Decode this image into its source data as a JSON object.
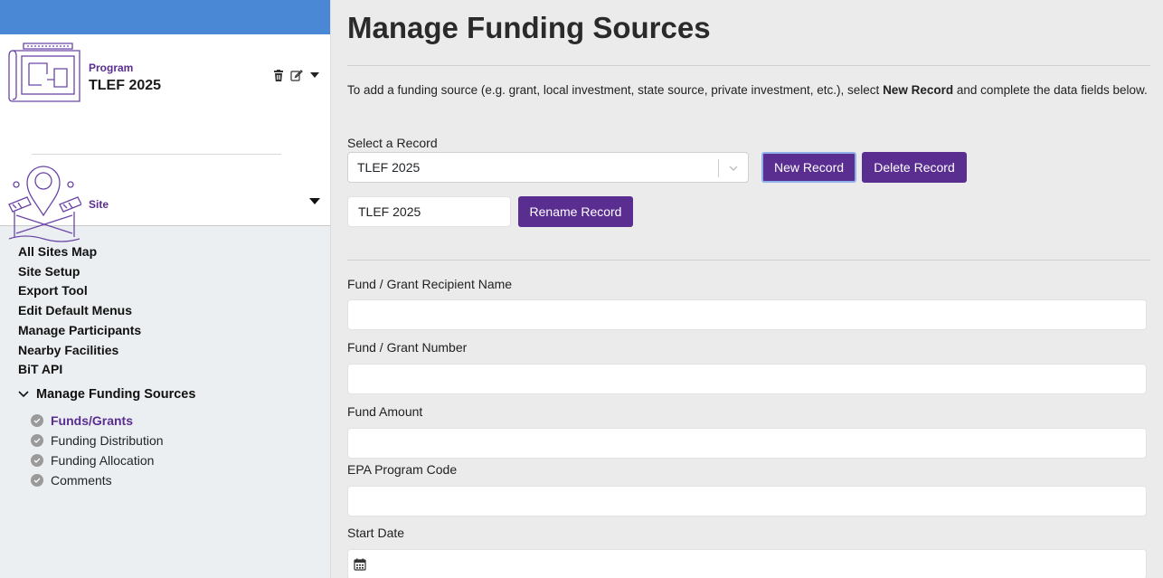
{
  "sidebar": {
    "program": {
      "kicker": "Program",
      "name": "TLEF 2025"
    },
    "site": {
      "label": "Site"
    },
    "nav": [
      {
        "label": "All Sites Map"
      },
      {
        "label": "Site Setup"
      },
      {
        "label": "Export Tool"
      },
      {
        "label": "Edit Default Menus"
      },
      {
        "label": "Manage Participants"
      },
      {
        "label": "Nearby Facilities"
      },
      {
        "label": "BiT API"
      }
    ],
    "section": {
      "label": "Manage Funding Sources",
      "items": [
        {
          "label": "Funds/Grants",
          "active": true
        },
        {
          "label": "Funding Distribution",
          "active": false
        },
        {
          "label": "Funding Allocation",
          "active": false
        },
        {
          "label": "Comments",
          "active": false
        }
      ]
    }
  },
  "main": {
    "title": "Manage Funding Sources",
    "intro_before": "To add a funding source (e.g. grant, local investment, state source, private investment, etc.), select ",
    "intro_bold": "New Record",
    "intro_after": " and complete the data fields below.",
    "select_label": "Select a Record",
    "selected_record": "TLEF 2025",
    "new_record_label": "New Record",
    "delete_record_label": "Delete Record",
    "rename_value": "TLEF 2025",
    "rename_record_label": "Rename Record",
    "fields": [
      {
        "label": "Fund / Grant Recipient Name",
        "value": ""
      },
      {
        "label": "Fund / Grant Number",
        "value": ""
      },
      {
        "label": "Fund Amount",
        "value": ""
      },
      {
        "label": "EPA Program Code",
        "value": ""
      },
      {
        "label": "Start Date",
        "value": ""
      }
    ]
  },
  "colors": {
    "accent": "#5a2d91",
    "topbar": "#4a88d6",
    "page_bg": "#ebebeb"
  }
}
